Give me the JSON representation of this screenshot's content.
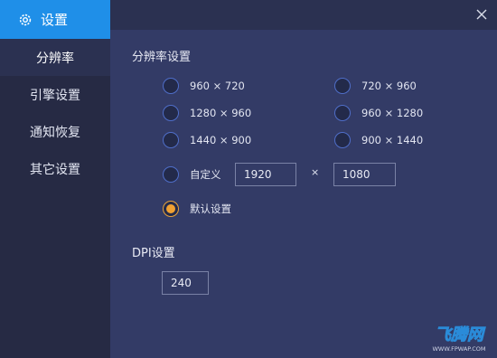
{
  "sidebar": {
    "title": "设置",
    "items": [
      {
        "label": "分辨率"
      },
      {
        "label": "引擎设置"
      },
      {
        "label": "通知恢复"
      },
      {
        "label": "其它设置"
      }
    ]
  },
  "resolution": {
    "section_title": "分辨率设置",
    "options": [
      {
        "label": "960 × 720"
      },
      {
        "label": "720 × 960"
      },
      {
        "label": "1280 × 960"
      },
      {
        "label": "960 × 1280"
      },
      {
        "label": "1440 × 900"
      },
      {
        "label": "900 × 1440"
      }
    ],
    "custom_label": "自定义",
    "custom_width": "1920",
    "times_sign": "×",
    "custom_height": "1080",
    "default_label": "默认设置"
  },
  "dpi": {
    "section_title": "DPI设置",
    "value": "240"
  },
  "watermark": {
    "text": "飞腾网",
    "url": "WWW.FPWAP.COM"
  },
  "colors": {
    "accent": "#1f8fe8",
    "sidebar_bg": "#262a44",
    "main_bg": "#333b66",
    "radio_selected": "#f0a032"
  }
}
